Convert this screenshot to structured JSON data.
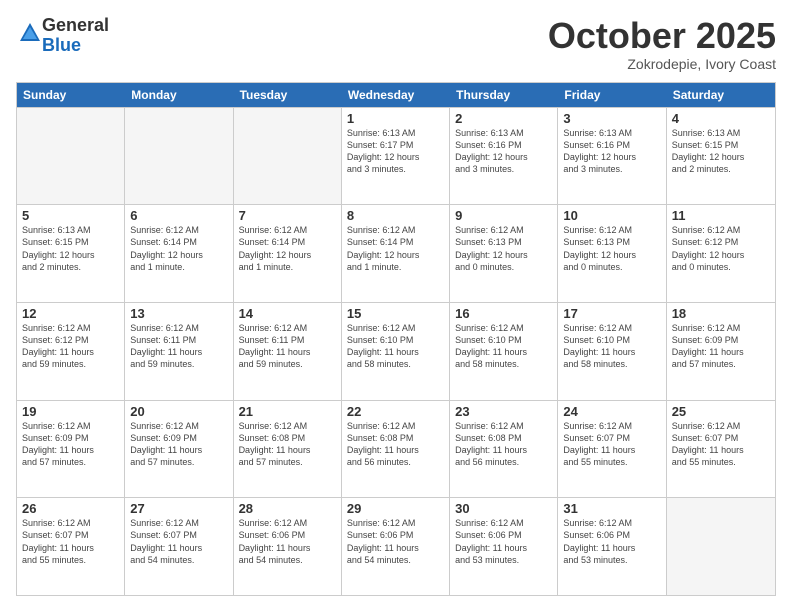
{
  "logo": {
    "general": "General",
    "blue": "Blue"
  },
  "title": "October 2025",
  "location": "Zokrodepie, Ivory Coast",
  "header": {
    "days": [
      "Sunday",
      "Monday",
      "Tuesday",
      "Wednesday",
      "Thursday",
      "Friday",
      "Saturday"
    ]
  },
  "weeks": [
    [
      {
        "day": "",
        "info": ""
      },
      {
        "day": "",
        "info": ""
      },
      {
        "day": "",
        "info": ""
      },
      {
        "day": "1",
        "info": "Sunrise: 6:13 AM\nSunset: 6:17 PM\nDaylight: 12 hours\nand 3 minutes."
      },
      {
        "day": "2",
        "info": "Sunrise: 6:13 AM\nSunset: 6:16 PM\nDaylight: 12 hours\nand 3 minutes."
      },
      {
        "day": "3",
        "info": "Sunrise: 6:13 AM\nSunset: 6:16 PM\nDaylight: 12 hours\nand 3 minutes."
      },
      {
        "day": "4",
        "info": "Sunrise: 6:13 AM\nSunset: 6:15 PM\nDaylight: 12 hours\nand 2 minutes."
      }
    ],
    [
      {
        "day": "5",
        "info": "Sunrise: 6:13 AM\nSunset: 6:15 PM\nDaylight: 12 hours\nand 2 minutes."
      },
      {
        "day": "6",
        "info": "Sunrise: 6:12 AM\nSunset: 6:14 PM\nDaylight: 12 hours\nand 1 minute."
      },
      {
        "day": "7",
        "info": "Sunrise: 6:12 AM\nSunset: 6:14 PM\nDaylight: 12 hours\nand 1 minute."
      },
      {
        "day": "8",
        "info": "Sunrise: 6:12 AM\nSunset: 6:14 PM\nDaylight: 12 hours\nand 1 minute."
      },
      {
        "day": "9",
        "info": "Sunrise: 6:12 AM\nSunset: 6:13 PM\nDaylight: 12 hours\nand 0 minutes."
      },
      {
        "day": "10",
        "info": "Sunrise: 6:12 AM\nSunset: 6:13 PM\nDaylight: 12 hours\nand 0 minutes."
      },
      {
        "day": "11",
        "info": "Sunrise: 6:12 AM\nSunset: 6:12 PM\nDaylight: 12 hours\nand 0 minutes."
      }
    ],
    [
      {
        "day": "12",
        "info": "Sunrise: 6:12 AM\nSunset: 6:12 PM\nDaylight: 11 hours\nand 59 minutes."
      },
      {
        "day": "13",
        "info": "Sunrise: 6:12 AM\nSunset: 6:11 PM\nDaylight: 11 hours\nand 59 minutes."
      },
      {
        "day": "14",
        "info": "Sunrise: 6:12 AM\nSunset: 6:11 PM\nDaylight: 11 hours\nand 59 minutes."
      },
      {
        "day": "15",
        "info": "Sunrise: 6:12 AM\nSunset: 6:10 PM\nDaylight: 11 hours\nand 58 minutes."
      },
      {
        "day": "16",
        "info": "Sunrise: 6:12 AM\nSunset: 6:10 PM\nDaylight: 11 hours\nand 58 minutes."
      },
      {
        "day": "17",
        "info": "Sunrise: 6:12 AM\nSunset: 6:10 PM\nDaylight: 11 hours\nand 58 minutes."
      },
      {
        "day": "18",
        "info": "Sunrise: 6:12 AM\nSunset: 6:09 PM\nDaylight: 11 hours\nand 57 minutes."
      }
    ],
    [
      {
        "day": "19",
        "info": "Sunrise: 6:12 AM\nSunset: 6:09 PM\nDaylight: 11 hours\nand 57 minutes."
      },
      {
        "day": "20",
        "info": "Sunrise: 6:12 AM\nSunset: 6:09 PM\nDaylight: 11 hours\nand 57 minutes."
      },
      {
        "day": "21",
        "info": "Sunrise: 6:12 AM\nSunset: 6:08 PM\nDaylight: 11 hours\nand 57 minutes."
      },
      {
        "day": "22",
        "info": "Sunrise: 6:12 AM\nSunset: 6:08 PM\nDaylight: 11 hours\nand 56 minutes."
      },
      {
        "day": "23",
        "info": "Sunrise: 6:12 AM\nSunset: 6:08 PM\nDaylight: 11 hours\nand 56 minutes."
      },
      {
        "day": "24",
        "info": "Sunrise: 6:12 AM\nSunset: 6:07 PM\nDaylight: 11 hours\nand 55 minutes."
      },
      {
        "day": "25",
        "info": "Sunrise: 6:12 AM\nSunset: 6:07 PM\nDaylight: 11 hours\nand 55 minutes."
      }
    ],
    [
      {
        "day": "26",
        "info": "Sunrise: 6:12 AM\nSunset: 6:07 PM\nDaylight: 11 hours\nand 55 minutes."
      },
      {
        "day": "27",
        "info": "Sunrise: 6:12 AM\nSunset: 6:07 PM\nDaylight: 11 hours\nand 54 minutes."
      },
      {
        "day": "28",
        "info": "Sunrise: 6:12 AM\nSunset: 6:06 PM\nDaylight: 11 hours\nand 54 minutes."
      },
      {
        "day": "29",
        "info": "Sunrise: 6:12 AM\nSunset: 6:06 PM\nDaylight: 11 hours\nand 54 minutes."
      },
      {
        "day": "30",
        "info": "Sunrise: 6:12 AM\nSunset: 6:06 PM\nDaylight: 11 hours\nand 53 minutes."
      },
      {
        "day": "31",
        "info": "Sunrise: 6:12 AM\nSunset: 6:06 PM\nDaylight: 11 hours\nand 53 minutes."
      },
      {
        "day": "",
        "info": ""
      }
    ]
  ]
}
